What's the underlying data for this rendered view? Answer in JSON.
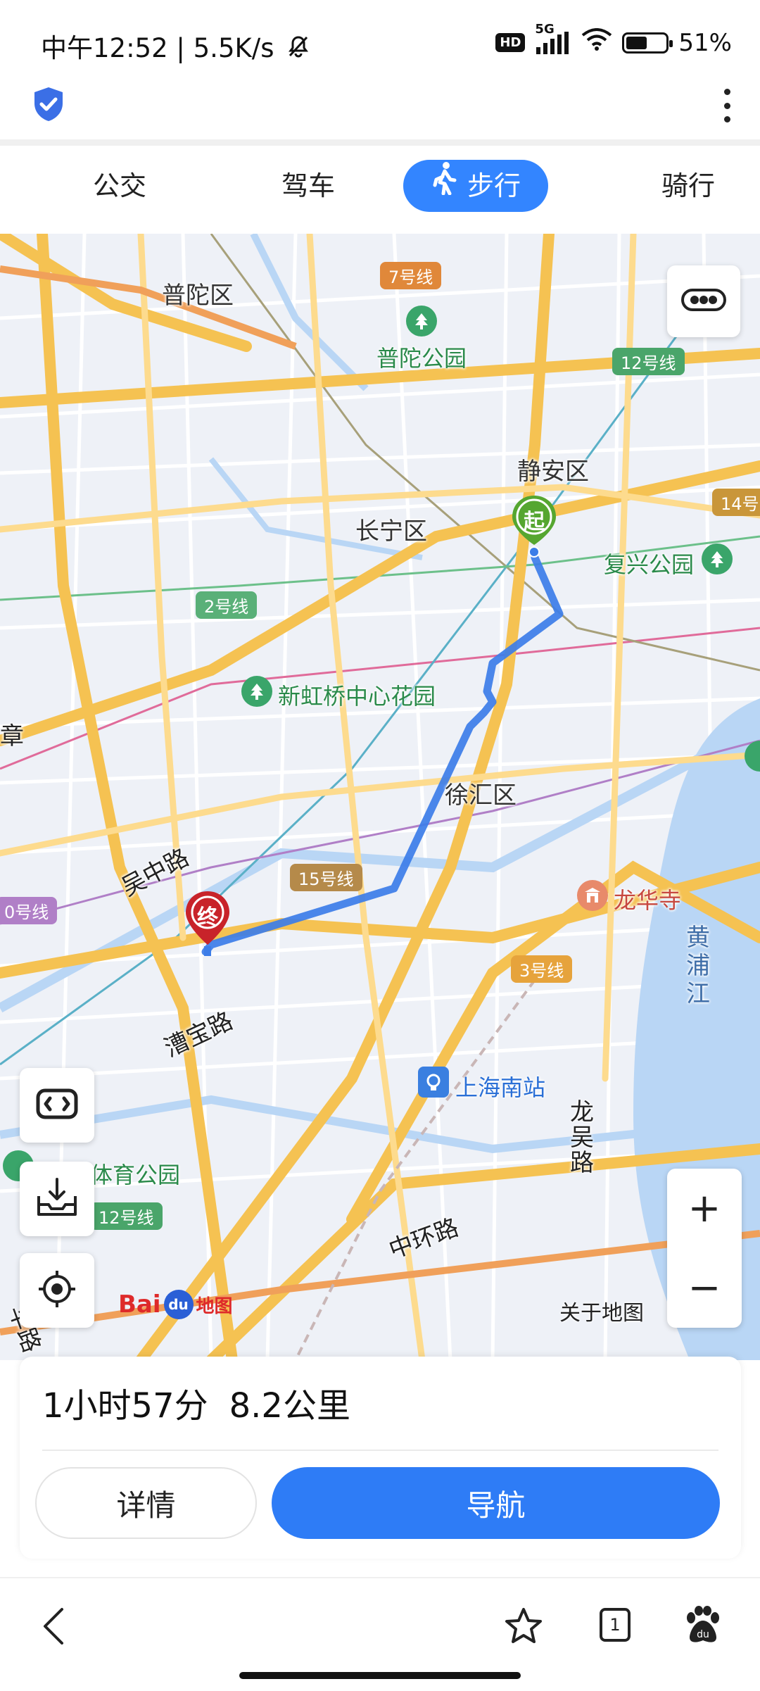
{
  "status_bar": {
    "time": "中午12:52",
    "speed": "5.5K/s",
    "hd": "HD",
    "network": "5G",
    "battery": "51%",
    "battery_level": 0.51
  },
  "app_bar": {
    "shield_icon": "shield-check-icon",
    "more_icon": "more-vertical-icon"
  },
  "tabs": [
    {
      "label": "公交",
      "active": false
    },
    {
      "label": "驾车",
      "active": false
    },
    {
      "label": "步行",
      "active": true,
      "icon": "walking-icon"
    },
    {
      "label": "骑行",
      "active": false
    }
  ],
  "map": {
    "district_labels": [
      "普陀区",
      "静安区",
      "长宁区",
      "徐汇区"
    ],
    "metro_lines": [
      "7号线",
      "12号线",
      "14号",
      "2号线",
      "15号线",
      "0号线",
      "3号线",
      "12号线"
    ],
    "metro_colors": {
      "7号线": "#e0883a",
      "12号线": "#4aa56a",
      "14号": "#c9963a",
      "2号线": "#5ab078",
      "15号线": "#b58a4a",
      "0号线": "#b07fc7",
      "3号线": "#e6a33c"
    },
    "pois": {
      "putuo_park": "普陀公园",
      "fuxing_park": "复兴公园",
      "xinhongqiao": "新虹桥中心花园",
      "longhua": "龙华寺",
      "south_station": "上海南站",
      "sports_park": "体育公园"
    },
    "roads": {
      "wuzhong": "吴中路",
      "caobao": "漕宝路",
      "longwu": "龙吴路",
      "zhonghuan": "中环路",
      "huaxin_partial": "华路",
      "edge_char": "章"
    },
    "river": "黄浦江",
    "start_marker": "起",
    "end_marker": "终",
    "layers_icon": "layers-toggle-icon",
    "street_view_icon": "street-view-icon",
    "download_icon": "offline-download-icon",
    "locate_icon": "locate-icon",
    "zoom_in": "+",
    "zoom_out": "−",
    "logo": {
      "bai": "Bai",
      "du": "du",
      "text": "地图"
    },
    "about": "关于地图",
    "route_color": "#3c7de8",
    "start_color": "#55a630",
    "end_color": "#c8232a"
  },
  "route": {
    "duration": "1小时57分",
    "distance": "8.2公里",
    "details_label": "详情",
    "navigate_label": "导航"
  },
  "browser_bar": {
    "back_icon": "back-arrow-icon",
    "star_icon": "star-icon",
    "tabs_count": "1",
    "baidu_icon": "baidu-paw-icon"
  }
}
